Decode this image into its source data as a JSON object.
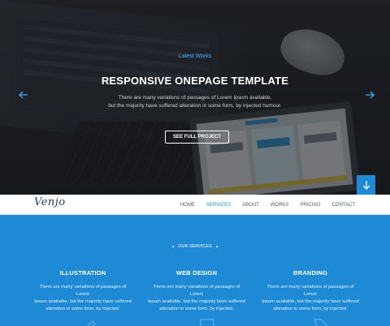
{
  "hero": {
    "kicker": "Latest Works",
    "title": "RESPONSIVE ONEPAGE TEMPLATE",
    "subtitle_lines": [
      "There are many variations of passages of Lorem Ipsum available,",
      "but the majority have suffered alteration in some form, by injected humour."
    ],
    "cta_label": "SEE FULL PROJECT",
    "prev_icon": "arrow-left-icon",
    "next_icon": "arrow-right-icon",
    "scroll_icon": "arrow-down-icon"
  },
  "nav": {
    "logo": "Venjo",
    "items": [
      {
        "label": "HOME",
        "active": false
      },
      {
        "label": "SERVICES",
        "active": true
      },
      {
        "label": "ABOUT",
        "active": false
      },
      {
        "label": "WORKS",
        "active": false
      },
      {
        "label": "PRICING",
        "active": false
      },
      {
        "label": "CONTACT",
        "active": false
      }
    ]
  },
  "services": {
    "section_label": "OUR SERVICES",
    "columns": [
      {
        "title": "ILLUSTRATION",
        "text_lines": [
          "There are many variations of passages of Lorem",
          "Ipsum available, but the majority have suffered",
          "alteration in some form, by injected."
        ]
      },
      {
        "title": "WEB DESIGN",
        "text_lines": [
          "There are many variations of passages of Lorem",
          "Ipsum available, but the majority have suffered",
          "alteration in some form, by injected."
        ]
      },
      {
        "title": "BRANDING",
        "text_lines": [
          "There are many variations of passages of Lorem",
          "Ipsum available, but the majority have suffered",
          "alteration in some form, by injected."
        ]
      }
    ]
  },
  "colors": {
    "accent": "#1e8ad6",
    "kicker": "#3fa9f5",
    "nav_active": "#1e8ad6",
    "nav_text": "#555a60"
  }
}
